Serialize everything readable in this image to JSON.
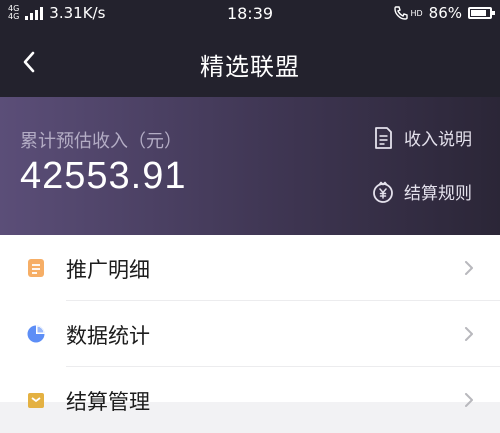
{
  "status_bar": {
    "network_top": "4G",
    "network_bottom": "4G",
    "speed": "3.31K/s",
    "time": "18:39",
    "hd_label": "HD",
    "battery_percent": "86%",
    "battery_level": 0.86
  },
  "nav": {
    "title": "精选联盟",
    "back_icon": "chevron-left-icon"
  },
  "income": {
    "label": "累计预估收入（元）",
    "value": "42553.91",
    "links": [
      {
        "label": "收入说明",
        "icon": "document-icon"
      },
      {
        "label": "结算规则",
        "icon": "yuan-badge-icon"
      }
    ]
  },
  "menu": {
    "items": [
      {
        "label": "推广明细",
        "icon": "list-doc-icon",
        "color": "#f5a04b"
      },
      {
        "label": "数据统计",
        "icon": "pie-chart-icon",
        "color": "#5d8ef6"
      },
      {
        "label": "结算管理",
        "icon": "wallet-icon",
        "color": "#e4b142"
      }
    ]
  },
  "colors": {
    "status_nav_bg": "#23222d",
    "header_gradient_start": "#5b4e78",
    "header_gradient_end": "#2b2637",
    "label_muted": "#b3acc4",
    "chevron": "#b8b8bd"
  }
}
